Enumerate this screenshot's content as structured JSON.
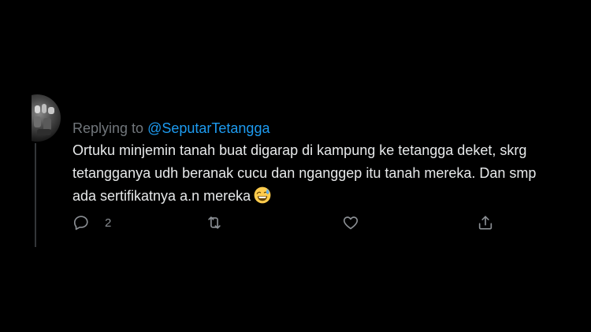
{
  "reply_context": {
    "prefix": "Replying to",
    "handle": "@SeputarTetangga"
  },
  "tweet": {
    "lines": [
      "Ortuku minjemin tanah buat digarap di kampung ke tetangga deket, skrg",
      "tetangganya udh beranak cucu dan nganggep itu tanah mereka. Dan smp",
      "ada sertifikatnya a.n mereka"
    ],
    "emoji": "grinning-face-with-sweat"
  },
  "actions": {
    "reply_count": "2",
    "retweet_count": "",
    "like_count": ""
  },
  "colors": {
    "background": "#000000",
    "text": "#e7e9ea",
    "muted": "#71767b",
    "accent": "#1d9bf0"
  }
}
